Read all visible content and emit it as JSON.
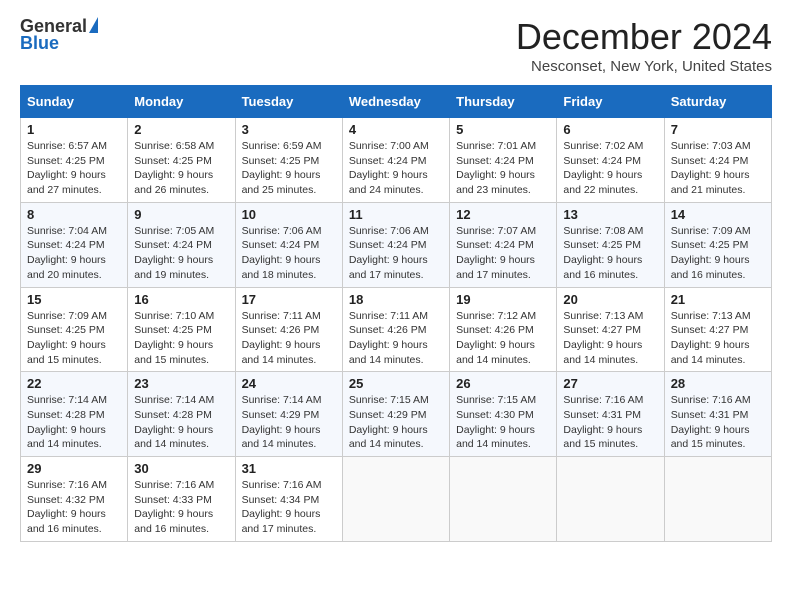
{
  "header": {
    "logo_general": "General",
    "logo_blue": "Blue",
    "title": "December 2024",
    "subtitle": "Nesconset, New York, United States"
  },
  "days_of_week": [
    "Sunday",
    "Monday",
    "Tuesday",
    "Wednesday",
    "Thursday",
    "Friday",
    "Saturday"
  ],
  "weeks": [
    [
      {
        "day": 1,
        "sunrise": "6:57 AM",
        "sunset": "4:25 PM",
        "daylight": "9 hours and 27 minutes."
      },
      {
        "day": 2,
        "sunrise": "6:58 AM",
        "sunset": "4:25 PM",
        "daylight": "9 hours and 26 minutes."
      },
      {
        "day": 3,
        "sunrise": "6:59 AM",
        "sunset": "4:25 PM",
        "daylight": "9 hours and 25 minutes."
      },
      {
        "day": 4,
        "sunrise": "7:00 AM",
        "sunset": "4:24 PM",
        "daylight": "9 hours and 24 minutes."
      },
      {
        "day": 5,
        "sunrise": "7:01 AM",
        "sunset": "4:24 PM",
        "daylight": "9 hours and 23 minutes."
      },
      {
        "day": 6,
        "sunrise": "7:02 AM",
        "sunset": "4:24 PM",
        "daylight": "9 hours and 22 minutes."
      },
      {
        "day": 7,
        "sunrise": "7:03 AM",
        "sunset": "4:24 PM",
        "daylight": "9 hours and 21 minutes."
      }
    ],
    [
      {
        "day": 8,
        "sunrise": "7:04 AM",
        "sunset": "4:24 PM",
        "daylight": "9 hours and 20 minutes."
      },
      {
        "day": 9,
        "sunrise": "7:05 AM",
        "sunset": "4:24 PM",
        "daylight": "9 hours and 19 minutes."
      },
      {
        "day": 10,
        "sunrise": "7:06 AM",
        "sunset": "4:24 PM",
        "daylight": "9 hours and 18 minutes."
      },
      {
        "day": 11,
        "sunrise": "7:06 AM",
        "sunset": "4:24 PM",
        "daylight": "9 hours and 17 minutes."
      },
      {
        "day": 12,
        "sunrise": "7:07 AM",
        "sunset": "4:24 PM",
        "daylight": "9 hours and 17 minutes."
      },
      {
        "day": 13,
        "sunrise": "7:08 AM",
        "sunset": "4:25 PM",
        "daylight": "9 hours and 16 minutes."
      },
      {
        "day": 14,
        "sunrise": "7:09 AM",
        "sunset": "4:25 PM",
        "daylight": "9 hours and 16 minutes."
      }
    ],
    [
      {
        "day": 15,
        "sunrise": "7:09 AM",
        "sunset": "4:25 PM",
        "daylight": "9 hours and 15 minutes."
      },
      {
        "day": 16,
        "sunrise": "7:10 AM",
        "sunset": "4:25 PM",
        "daylight": "9 hours and 15 minutes."
      },
      {
        "day": 17,
        "sunrise": "7:11 AM",
        "sunset": "4:26 PM",
        "daylight": "9 hours and 14 minutes."
      },
      {
        "day": 18,
        "sunrise": "7:11 AM",
        "sunset": "4:26 PM",
        "daylight": "9 hours and 14 minutes."
      },
      {
        "day": 19,
        "sunrise": "7:12 AM",
        "sunset": "4:26 PM",
        "daylight": "9 hours and 14 minutes."
      },
      {
        "day": 20,
        "sunrise": "7:13 AM",
        "sunset": "4:27 PM",
        "daylight": "9 hours and 14 minutes."
      },
      {
        "day": 21,
        "sunrise": "7:13 AM",
        "sunset": "4:27 PM",
        "daylight": "9 hours and 14 minutes."
      }
    ],
    [
      {
        "day": 22,
        "sunrise": "7:14 AM",
        "sunset": "4:28 PM",
        "daylight": "9 hours and 14 minutes."
      },
      {
        "day": 23,
        "sunrise": "7:14 AM",
        "sunset": "4:28 PM",
        "daylight": "9 hours and 14 minutes."
      },
      {
        "day": 24,
        "sunrise": "7:14 AM",
        "sunset": "4:29 PM",
        "daylight": "9 hours and 14 minutes."
      },
      {
        "day": 25,
        "sunrise": "7:15 AM",
        "sunset": "4:29 PM",
        "daylight": "9 hours and 14 minutes."
      },
      {
        "day": 26,
        "sunrise": "7:15 AM",
        "sunset": "4:30 PM",
        "daylight": "9 hours and 14 minutes."
      },
      {
        "day": 27,
        "sunrise": "7:16 AM",
        "sunset": "4:31 PM",
        "daylight": "9 hours and 15 minutes."
      },
      {
        "day": 28,
        "sunrise": "7:16 AM",
        "sunset": "4:31 PM",
        "daylight": "9 hours and 15 minutes."
      }
    ],
    [
      {
        "day": 29,
        "sunrise": "7:16 AM",
        "sunset": "4:32 PM",
        "daylight": "9 hours and 16 minutes."
      },
      {
        "day": 30,
        "sunrise": "7:16 AM",
        "sunset": "4:33 PM",
        "daylight": "9 hours and 16 minutes."
      },
      {
        "day": 31,
        "sunrise": "7:16 AM",
        "sunset": "4:34 PM",
        "daylight": "9 hours and 17 minutes."
      },
      null,
      null,
      null,
      null
    ]
  ]
}
